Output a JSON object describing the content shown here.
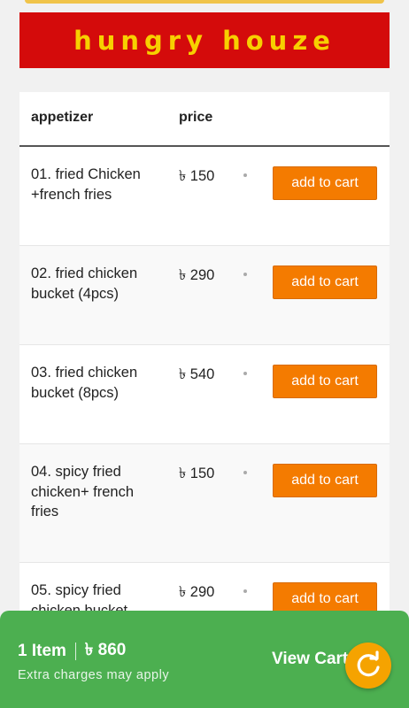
{
  "header": {
    "title": "hungry houze"
  },
  "table": {
    "col_item": "appetizer",
    "col_price": "price",
    "rows": [
      {
        "name": "01. fried Chicken +french fries",
        "price": "৳ 150",
        "button": "add to cart"
      },
      {
        "name": "02. fried chicken bucket (4pcs)",
        "price": "৳ 290",
        "button": "add to cart"
      },
      {
        "name": "03. fried chicken bucket (8pcs)",
        "price": "৳ 540",
        "button": "add to cart"
      },
      {
        "name": "04. spicy fried chicken+ french fries",
        "price": "৳ 150",
        "button": "add to cart"
      },
      {
        "name": "05. spicy fried chicken bucket",
        "price": "৳ 290",
        "button": "add to cart"
      }
    ]
  },
  "cart": {
    "items": "1 Item",
    "total": "৳ 860",
    "note": "Extra charges may apply",
    "view_label": "View Cart"
  },
  "colors": {
    "banner": "#d40b0b",
    "banner_text": "#f7d000",
    "button": "#f47b00",
    "cart_bar": "#4caf50",
    "refresh": "#f5a300"
  },
  "icons": {
    "refresh": "refresh-icon"
  }
}
